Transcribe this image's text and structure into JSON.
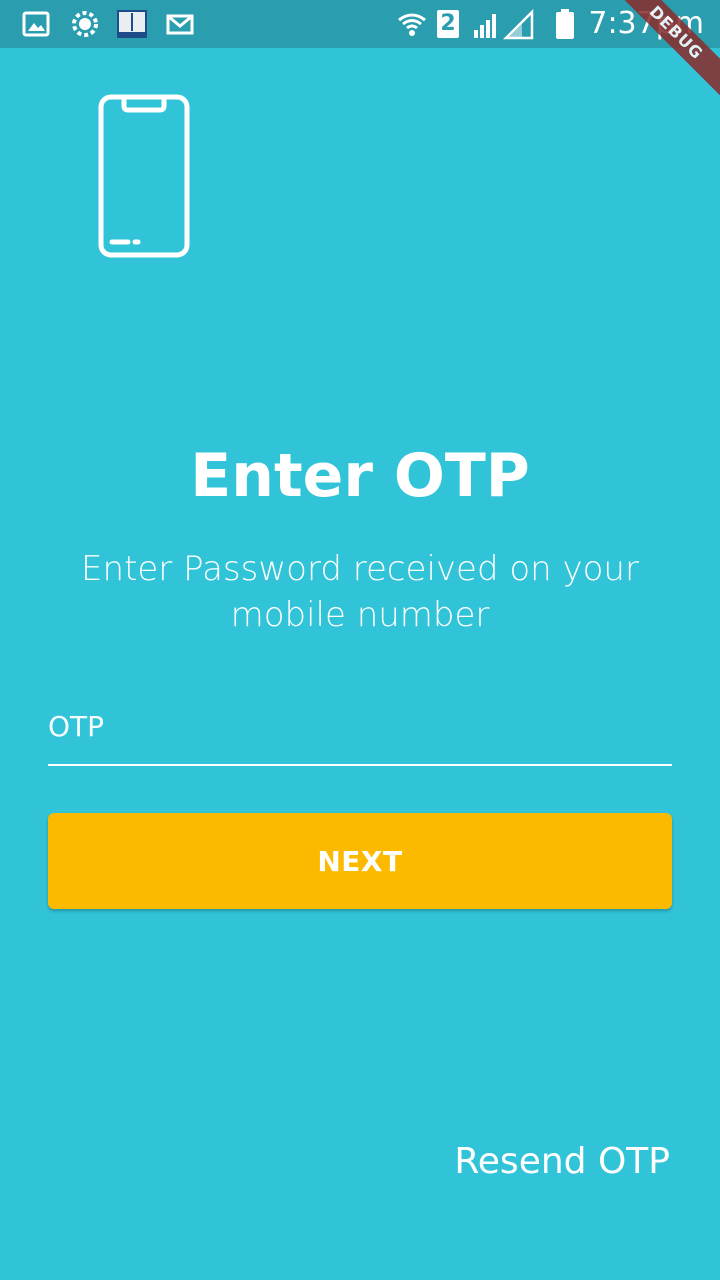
{
  "status_bar": {
    "time": "7:37pm",
    "sim_badge": "2",
    "icons": [
      "gallery-icon",
      "settings-app-icon",
      "dictionary-app-icon",
      "mail-icon",
      "wifi-icon",
      "signal-icon",
      "battery-icon"
    ]
  },
  "debug_ribbon": "DEBUG",
  "screen": {
    "title": "Enter OTP",
    "subtitle": "Enter Password received on your mobile number",
    "otp_placeholder": "OTP",
    "otp_value": "",
    "next_label": "NEXT",
    "resend_label": "Resend OTP"
  },
  "colors": {
    "background": "#31C4D8",
    "status_bar": "#2A9DAE",
    "button": "#FBBA00",
    "text": "#FFFFFF",
    "debug_ribbon": "#8B2A2A"
  }
}
